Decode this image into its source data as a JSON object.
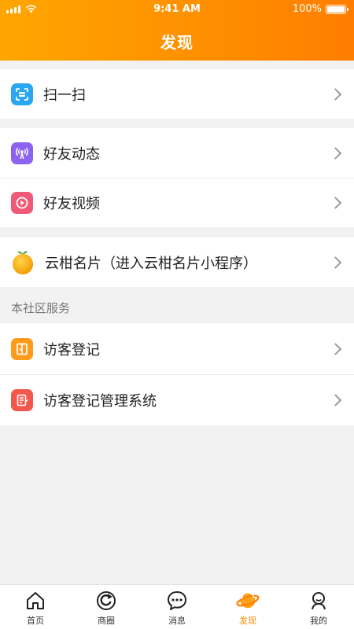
{
  "status": {
    "time": "9:41 AM",
    "battery": "100%"
  },
  "header": {
    "title": "发现"
  },
  "groups": {
    "scan": {
      "label": "扫一扫"
    },
    "friends": {
      "moments": "好友动态",
      "videos": "好友视频"
    },
    "card": {
      "label": "云柑名片（进入云柑名片小程序）"
    },
    "community": {
      "caption": "本社区服务",
      "visitor": "访客登记",
      "visitor_mgmt": "访客登记管理系统"
    }
  },
  "tabbar": {
    "items": [
      {
        "label": "首页",
        "icon": "home-icon"
      },
      {
        "label": "商圈",
        "icon": "circle-icon"
      },
      {
        "label": "消息",
        "icon": "chat-icon"
      },
      {
        "label": "发现",
        "icon": "planet-icon",
        "active": true
      },
      {
        "label": "我的",
        "icon": "person-icon"
      }
    ]
  },
  "colors": {
    "header_gradient_start": "#ffa600",
    "header_gradient_end": "#ff7e00",
    "active_tab": "#ff8a00",
    "scan_icon": "#2aa7f0",
    "moments_icon": "#8c62f0",
    "videos_icon": "#f05a78",
    "visitor_icon": "#ff9a1a",
    "visitor_mgmt_icon": "#f2574c"
  }
}
